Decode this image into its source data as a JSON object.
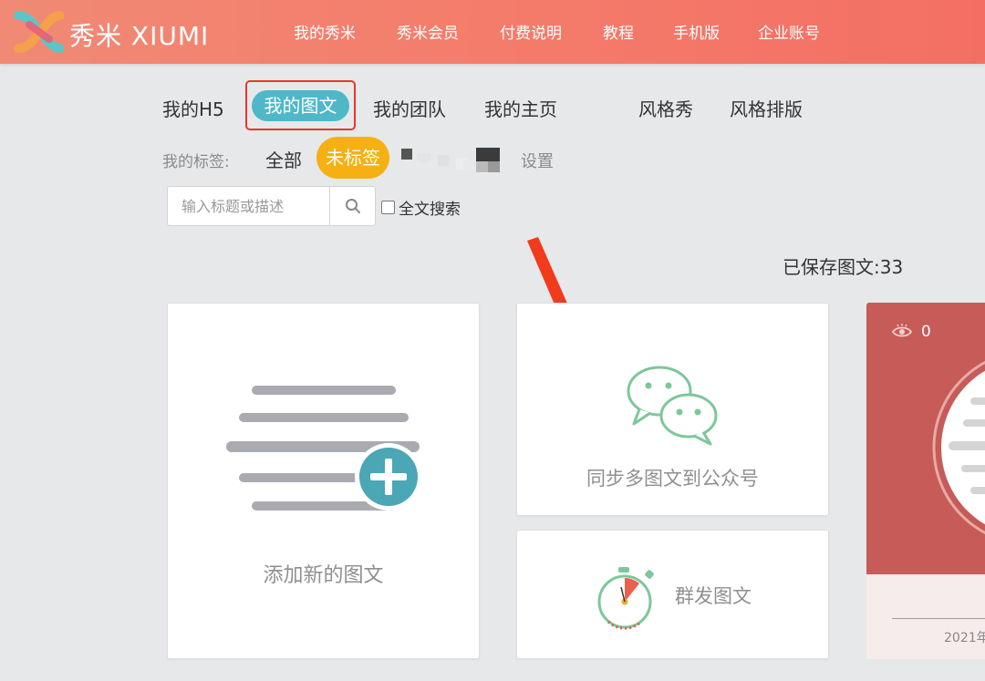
{
  "brand": {
    "name": "秀米 XIUMI",
    "color": "#f47c6b"
  },
  "topnav": [
    "我的秀米",
    "秀米会员",
    "付费说明",
    "教程",
    "手机版",
    "企业账号"
  ],
  "tabs": [
    "我的H5",
    "我的图文",
    "我的团队",
    "我的主页",
    "风格秀",
    "风格排版"
  ],
  "active_tab": "我的图文",
  "tags": {
    "label": "我的标签:",
    "all": "全部",
    "untagged": "未标签",
    "settings": "设置"
  },
  "search": {
    "placeholder": "输入标题或描述",
    "value": ""
  },
  "fulltext_search": {
    "label": "全文搜索",
    "checked": false
  },
  "saved_count": "已保存图文:33",
  "cards": {
    "add": "添加新的图文",
    "sync": "同步多图文到公众号",
    "mass": "群发图文"
  },
  "article_card": {
    "views": "0",
    "date": "2021年"
  },
  "colors": {
    "accent_teal": "#4eb8c9",
    "accent_orange": "#f7b014",
    "highlight_red": "#e8372b",
    "wechat_green": "#7cc79b"
  }
}
